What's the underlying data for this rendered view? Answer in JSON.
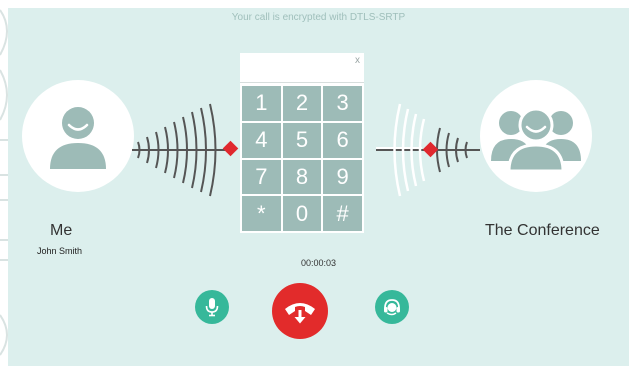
{
  "call": {
    "encryption_note": "Your call is encrypted with DTLS-SRTP",
    "timer": "00:00:03"
  },
  "local_party": {
    "name": "Me",
    "subtitle": "John Smith"
  },
  "remote_party": {
    "name": "The Conference"
  },
  "dialpad": {
    "close_label": "x",
    "keys": [
      "1",
      "2",
      "3",
      "4",
      "5",
      "6",
      "7",
      "8",
      "9",
      "*",
      "0",
      "#"
    ]
  },
  "icons": {
    "mute": "microphone-icon",
    "hangup": "phone-hangup-icon",
    "headset": "headset-icon",
    "me_avatar": "user-icon",
    "conference_avatar": "group-icon"
  },
  "colors": {
    "background": "#dcefed",
    "avatar_fill": "#9dbbb7",
    "key_fill": "#9dbbb7",
    "action_green": "#36b89a",
    "hangup_red": "#e22b2b",
    "signal_red": "#e0282e"
  }
}
